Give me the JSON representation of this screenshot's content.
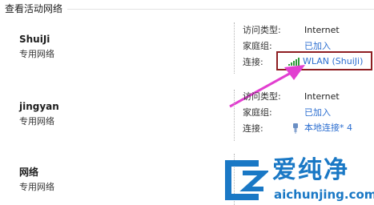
{
  "section_header": "查看活动网络",
  "networks": [
    {
      "name": "ShuiJi",
      "type": "专用网络",
      "access_label": "访问类型:",
      "access_value": "Internet",
      "homegroup_label": "家庭组:",
      "homegroup_value": "已加入",
      "connection_label": "连接:",
      "connection_value": "WLAN (ShuiJi)",
      "connection_icon": "wifi-signal-icon"
    },
    {
      "name": "jingyan",
      "type": "专用网络",
      "access_label": "访问类型:",
      "access_value": "Internet",
      "homegroup_label": "家庭组:",
      "homegroup_value": "已加入",
      "connection_label": "连接:",
      "connection_value": "本地连接* 4",
      "connection_icon": "ethernet-cable-icon"
    },
    {
      "name": "网络",
      "type": "专用网络"
    }
  ],
  "watermark": {
    "title": "爱纯净",
    "url": "aichunjing.com"
  },
  "colors": {
    "link": "#2b6ed0",
    "highlight_box": "#8e1e22",
    "arrow": "#e23fd0",
    "watermark": "#1a78c5"
  }
}
